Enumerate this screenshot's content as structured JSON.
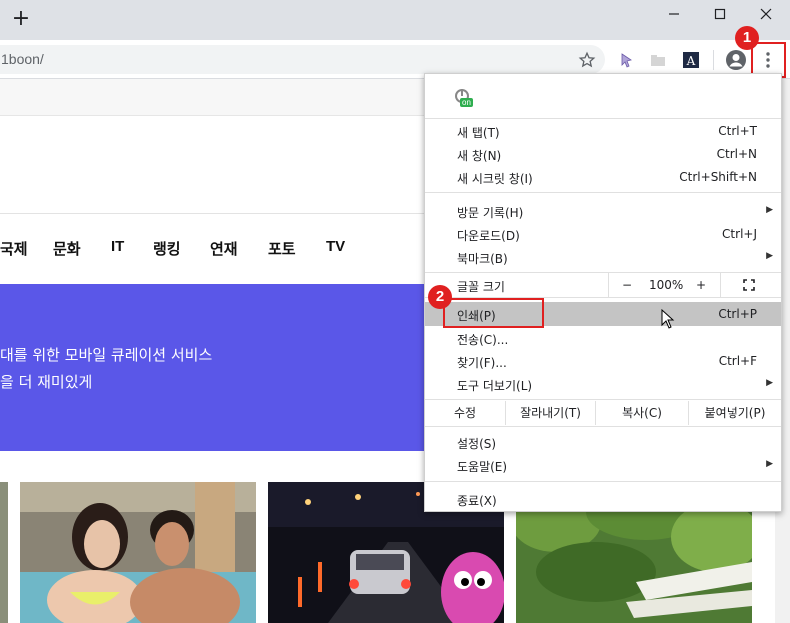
{
  "browser": {
    "new_tab_symbol": "+",
    "url": "1boon/",
    "window_controls": [
      "minimize",
      "maximize",
      "close"
    ]
  },
  "annotations": {
    "step1": "1",
    "step2": "2",
    "highlight_color": "#e02020"
  },
  "page": {
    "nav": [
      "국제",
      "문화",
      "IT",
      "랭킹",
      "연재",
      "포토",
      "TV"
    ],
    "hero": {
      "line1": "대를 위한 모바일 큐레이션 서비스",
      "line2": "을 더 재미있게",
      "color": "#5a57e8"
    }
  },
  "menu": {
    "extension_badge": "on",
    "items_group1": [
      {
        "label": "새 탭(T)",
        "shortcut": "Ctrl+T"
      },
      {
        "label": "새 창(N)",
        "shortcut": "Ctrl+N"
      },
      {
        "label": "새 시크릿 창(I)",
        "shortcut": "Ctrl+Shift+N"
      }
    ],
    "items_group2": [
      {
        "label": "방문 기록(H)",
        "shortcut": ""
      },
      {
        "label": "다운로드(D)",
        "shortcut": "Ctrl+J"
      },
      {
        "label": "북마크(B)",
        "shortcut": ""
      }
    ],
    "zoom": {
      "label": "글꼴 크기",
      "minus": "−",
      "value": "100%",
      "plus": "+"
    },
    "items_group3": [
      {
        "label": "인쇄(P)",
        "shortcut": "Ctrl+P"
      },
      {
        "label": "전송(C)...",
        "shortcut": ""
      },
      {
        "label": "찾기(F)...",
        "shortcut": "Ctrl+F"
      },
      {
        "label": "도구 더보기(L)",
        "shortcut": ""
      }
    ],
    "edit": {
      "label": "수정",
      "cut": "잘라내기(T)",
      "copy": "복사(C)",
      "paste": "붙여넣기(P)"
    },
    "items_group4": [
      {
        "label": "설정(S)",
        "shortcut": ""
      },
      {
        "label": "도움말(E)",
        "shortcut": ""
      }
    ],
    "exit": "종료(X)"
  }
}
